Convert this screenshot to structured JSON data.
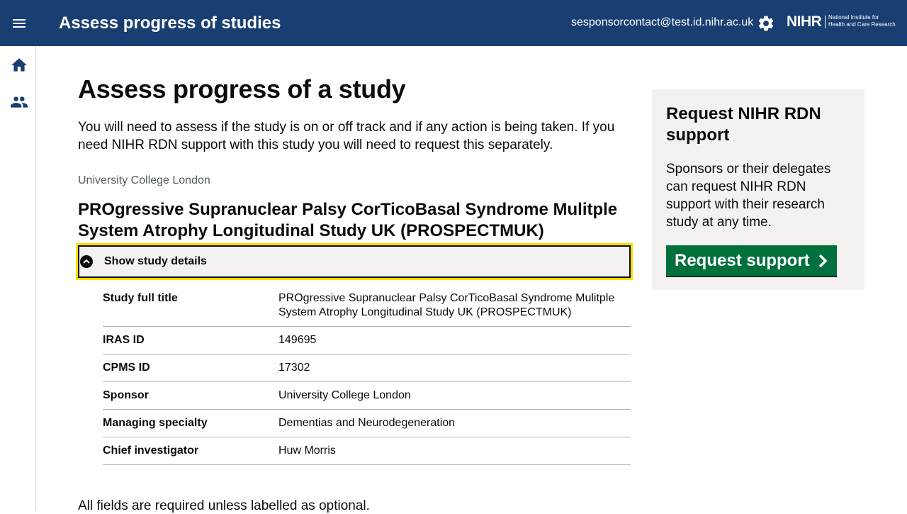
{
  "header": {
    "app_title": "Assess progress of studies",
    "user_email": "sesponsorcontact@test.id.nihr.ac.uk",
    "logo_mark": "NIHR",
    "logo_text": "National Institute for\nHealth and Care Research",
    "background_color": "#193e72",
    "icons": [
      "menu-icon",
      "gear-icon"
    ]
  },
  "sidenav": {
    "icons": [
      "home-icon",
      "people-icon"
    ]
  },
  "main": {
    "page_title": "Assess progress of a study",
    "intro": "You will need to assess if the study is on or off track and if any action is being taken. If you need NIHR RDN support with this study you will need to request this separately.",
    "caption": "University College London",
    "study_title": "PROgressive Supranuclear Palsy CorTicoBasal Syndrome Mulitple System Atrophy Longitudinal Study UK (PROSPECTMUK)",
    "details_toggle_label": "Show study details",
    "details_expanded": true,
    "summary": [
      {
        "key": "Study full title",
        "value": "PROgressive Supranuclear Palsy CorTicoBasal Syndrome Mulitple System Atrophy Longitudinal Study UK (PROSPECTMUK)"
      },
      {
        "key": "IRAS ID",
        "value": "149695"
      },
      {
        "key": "CPMS ID",
        "value": "17302"
      },
      {
        "key": "Sponsor",
        "value": "University College London"
      },
      {
        "key": "Managing specialty",
        "value": "Dementias and Neurodegeneration"
      },
      {
        "key": "Chief investigator",
        "value": "Huw Morris"
      }
    ],
    "footer_note": "All fields are required unless labelled as optional."
  },
  "panel": {
    "title": "Request NIHR RDN support",
    "body": "Sponsors or their delegates can request NIHR RDN support with their research study at any time.",
    "button_label": "Request support",
    "button_color": "#00703c"
  },
  "colors": {
    "focus": "#ffdd00",
    "panel_bg": "#f3f2f1",
    "caption": "#505a5f"
  }
}
